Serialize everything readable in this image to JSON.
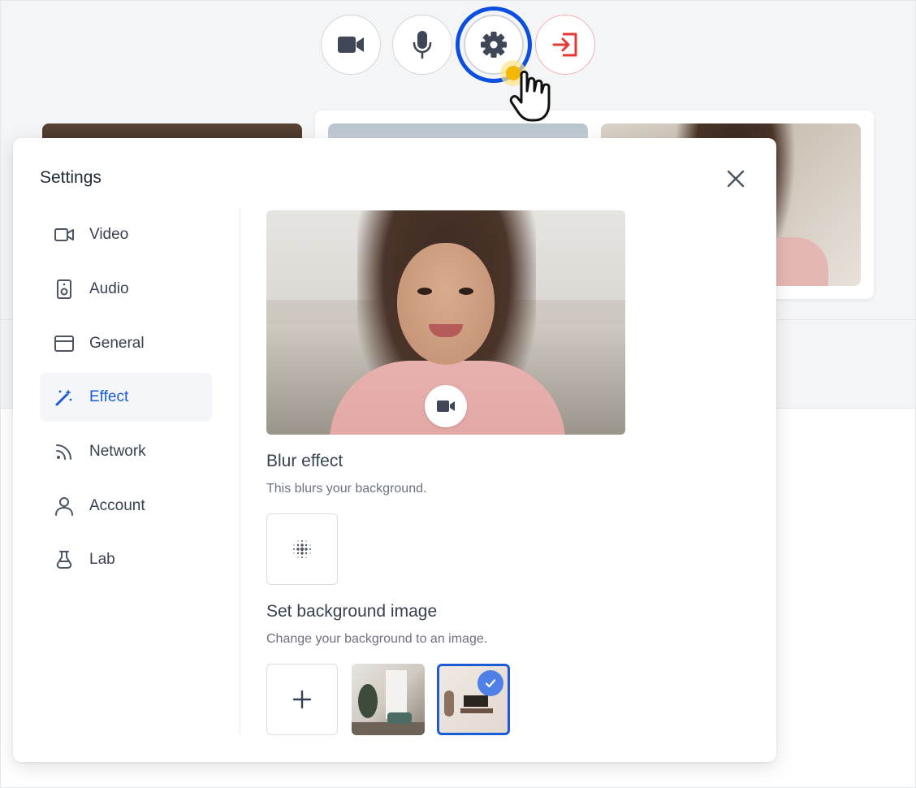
{
  "controls": {
    "video_icon": "video-camera-icon",
    "mic_icon": "microphone-icon",
    "settings_icon": "gear-icon",
    "leave_icon": "leave-icon",
    "leave_color": "#e53935",
    "focus_ring_color": "#0b4fe0"
  },
  "settings": {
    "title": "Settings",
    "nav": [
      {
        "label": "Video",
        "icon": "video-icon"
      },
      {
        "label": "Audio",
        "icon": "speaker-icon"
      },
      {
        "label": "General",
        "icon": "window-icon"
      },
      {
        "label": "Effect",
        "icon": "magic-wand-icon",
        "active": true
      },
      {
        "label": "Network",
        "icon": "rss-icon"
      },
      {
        "label": "Account",
        "icon": "user-icon"
      },
      {
        "label": "Lab",
        "icon": "flask-icon"
      }
    ],
    "accent_color": "#1d5bd6",
    "blur": {
      "title": "Blur effect",
      "description": "This blurs your background."
    },
    "background": {
      "title": "Set background image",
      "description": "Change your background to an image.",
      "add_label": "+",
      "selected_index": 1
    }
  }
}
